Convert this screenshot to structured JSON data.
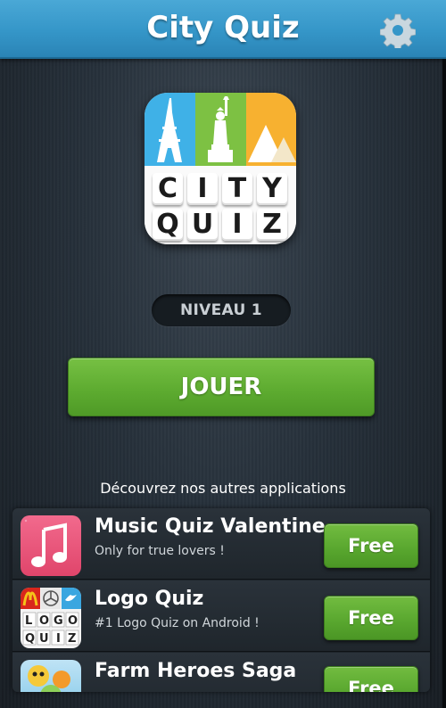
{
  "header": {
    "title": "City Quiz",
    "settings_icon": "gear-icon"
  },
  "logo": {
    "row1": [
      "C",
      "I",
      "T",
      "Y"
    ],
    "row2": [
      "Q",
      "U",
      "I",
      "Z"
    ]
  },
  "level": {
    "label": "NIVEAU 1"
  },
  "play": {
    "label": "JOUER"
  },
  "discover": {
    "label": "Découvrez nos autres applications"
  },
  "apps": [
    {
      "name": "Music Quiz Valentine",
      "subtitle": "Only for true lovers !",
      "button": "Free",
      "icon": "music-note-icon"
    },
    {
      "name": "Logo Quiz",
      "subtitle": "#1 Logo Quiz on Android !",
      "button": "Free",
      "icon": "logo-quiz-icon"
    },
    {
      "name": "Farm Heroes Saga",
      "subtitle": "",
      "button": "Free",
      "icon": "farm-heroes-icon"
    }
  ],
  "colors": {
    "header": "#3596c8",
    "play": "#5caa2f",
    "free": "#58a62e"
  }
}
